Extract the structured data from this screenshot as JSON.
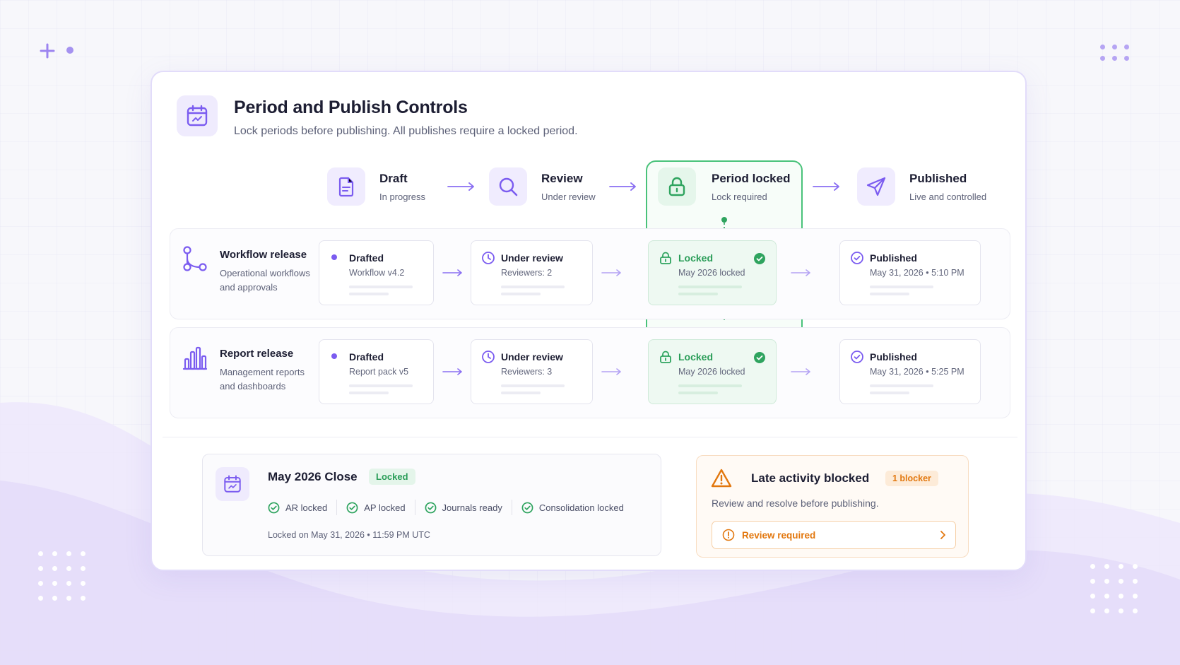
{
  "header": {
    "title": "Period and Publish Controls",
    "subtitle": "Lock periods before publishing. All publishes require a locked period.",
    "icon": "calendar-icon"
  },
  "stages": [
    {
      "label": "Draft",
      "sub": "In progress",
      "icon": "document-icon"
    },
    {
      "label": "Review",
      "sub": "Under review",
      "icon": "search-icon"
    },
    {
      "label": "Period locked",
      "sub": "Lock required",
      "icon": "lock-icon"
    },
    {
      "label": "Published",
      "sub": "Live and controlled",
      "icon": "send-icon"
    }
  ],
  "rows": [
    {
      "title": "Workflow release",
      "desc": "Operational workflows and approvals",
      "icon": "workflow-icon",
      "draft": {
        "title": "Drafted",
        "sub": "Workflow v4.2"
      },
      "review": {
        "title": "Under review",
        "sub": "Reviewers: 2"
      },
      "locked": {
        "title": "Locked",
        "sub": "May 2026 locked"
      },
      "published": {
        "title": "Published",
        "sub": "May 31, 2026 • 5:10 PM"
      }
    },
    {
      "title": "Report release",
      "desc": "Management reports and dashboards",
      "icon": "bar-chart-icon",
      "draft": {
        "title": "Drafted",
        "sub": "Report pack v5"
      },
      "review": {
        "title": "Under review",
        "sub": "Reviewers: 3"
      },
      "locked": {
        "title": "Locked",
        "sub": "May 2026 locked"
      },
      "published": {
        "title": "Published",
        "sub": "May 31, 2026 • 5:25 PM"
      }
    }
  ],
  "close": {
    "title": "May 2026 Close",
    "badge": "Locked",
    "checks": [
      "AR locked",
      "AP locked",
      "Journals ready",
      "Consolidation locked"
    ],
    "footer": "Locked on May 31, 2026  •  11:59 PM UTC"
  },
  "blocker": {
    "title": "Late activity blocked",
    "badge": "1 blocker",
    "desc": "Review and resolve before publishing.",
    "button": "Review required"
  },
  "colors": {
    "accent": "#7b5cf0",
    "success": "#2fa45f",
    "warning": "#e2770e"
  }
}
